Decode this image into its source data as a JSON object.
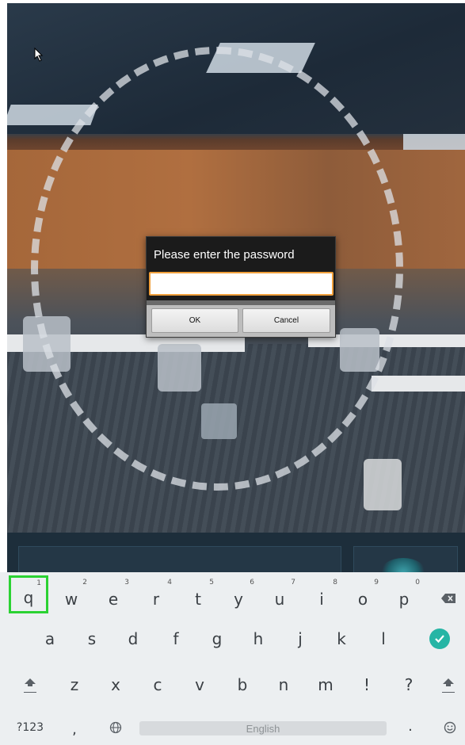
{
  "dialog": {
    "title": "Please enter the password",
    "password_value": "",
    "ok_label": "OK",
    "cancel_label": "Cancel"
  },
  "keyboard": {
    "row1": [
      {
        "key": "q",
        "hint": "1"
      },
      {
        "key": "w",
        "hint": "2"
      },
      {
        "key": "e",
        "hint": "3"
      },
      {
        "key": "r",
        "hint": "4"
      },
      {
        "key": "t",
        "hint": "5"
      },
      {
        "key": "y",
        "hint": "6"
      },
      {
        "key": "u",
        "hint": "7"
      },
      {
        "key": "i",
        "hint": "8"
      },
      {
        "key": "o",
        "hint": "9"
      },
      {
        "key": "p",
        "hint": "0"
      }
    ],
    "row2": [
      "a",
      "s",
      "d",
      "f",
      "g",
      "h",
      "j",
      "k",
      "l"
    ],
    "row3": [
      "z",
      "x",
      "c",
      "v",
      "b",
      "n",
      "m",
      "!",
      "?"
    ],
    "symbols_label": "?123",
    "comma_label": ",",
    "period_label": ".",
    "space_label": "English",
    "icons": {
      "backspace": "backspace-icon",
      "enter": "check-icon",
      "shift": "shift-icon",
      "globe": "globe-icon",
      "emoji": "emoji-icon"
    },
    "colors": {
      "highlight": "#2bd233",
      "enter": "#26b5a5",
      "background": "#eceff1"
    }
  },
  "colors": {
    "dialog_background": "#1b1b1b",
    "input_focus_border": "#f0a03c"
  }
}
